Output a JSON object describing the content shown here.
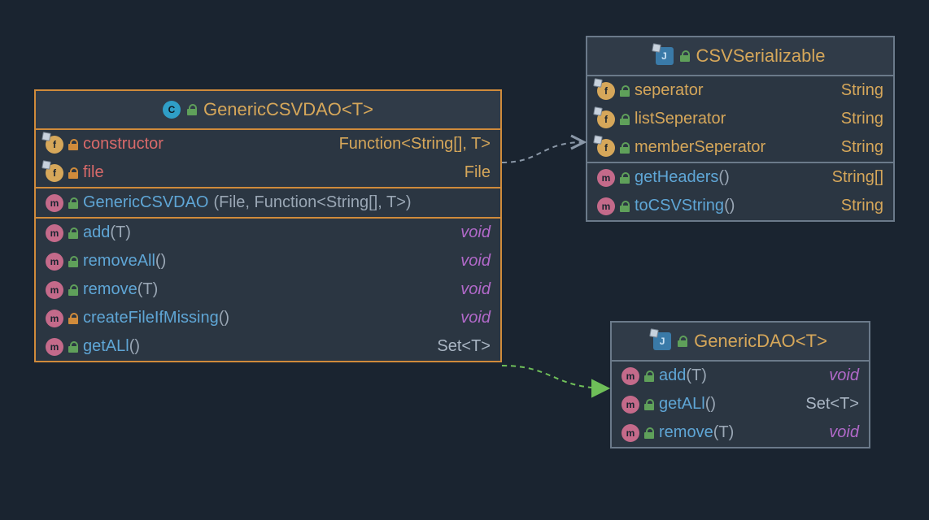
{
  "classes": {
    "genericCsvDao": {
      "title": "GenericCSVDAO<T>",
      "fields": [
        {
          "name": "constructor",
          "type": "Function<String[], T>",
          "vis": "private"
        },
        {
          "name": "file",
          "type": "File",
          "vis": "private"
        }
      ],
      "constructor": {
        "name": "GenericCSVDAO",
        "params": "(File, Function<String[], T>)"
      },
      "methods": [
        {
          "name": "add",
          "params": "(T)",
          "ret": "void",
          "vis": "public"
        },
        {
          "name": "removeAll",
          "params": "()",
          "ret": "void",
          "vis": "public"
        },
        {
          "name": "remove",
          "params": "(T)",
          "ret": "void",
          "vis": "public"
        },
        {
          "name": "createFileIfMissing",
          "params": "()",
          "ret": "void",
          "vis": "private"
        },
        {
          "name": "getALl",
          "params": "()",
          "ret": "Set<T>",
          "vis": "public"
        }
      ]
    },
    "csvSerializable": {
      "title": "CSVSerializable",
      "fields": [
        {
          "name": "seperator",
          "type": "String"
        },
        {
          "name": "listSeperator",
          "type": "String"
        },
        {
          "name": "memberSeperator",
          "type": "String"
        }
      ],
      "methods": [
        {
          "name": "getHeaders",
          "params": "()",
          "ret": "String[]"
        },
        {
          "name": "toCSVString",
          "params": "()",
          "ret": "String"
        }
      ]
    },
    "genericDao": {
      "title": "GenericDAO<T>",
      "methods": [
        {
          "name": "add",
          "params": "(T)",
          "ret": "void"
        },
        {
          "name": "getALl",
          "params": "()",
          "ret": "Set<T>"
        },
        {
          "name": "remove",
          "params": "(T)",
          "ret": "void"
        }
      ]
    }
  }
}
